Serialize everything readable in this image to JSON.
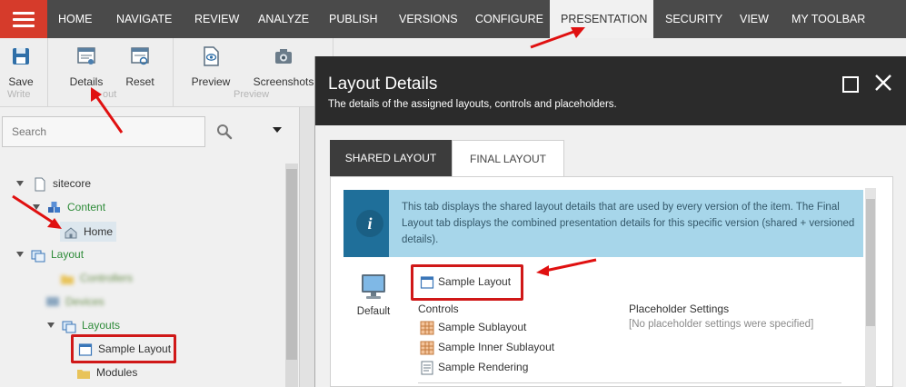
{
  "nav": {
    "tabs": [
      {
        "label": "HOME"
      },
      {
        "label": "NAVIGATE"
      },
      {
        "label": "REVIEW"
      },
      {
        "label": "ANALYZE"
      },
      {
        "label": "PUBLISH"
      },
      {
        "label": "VERSIONS"
      },
      {
        "label": "CONFIGURE"
      },
      {
        "label": "PRESENTATION"
      },
      {
        "label": "SECURITY"
      },
      {
        "label": "VIEW"
      },
      {
        "label": "MY TOOLBAR"
      }
    ],
    "active_tab": "PRESENTATION"
  },
  "ribbon": {
    "save": "Save",
    "details": "Details",
    "reset": "Reset",
    "preview": "Preview",
    "screenshots": "Screenshots",
    "groups": {
      "write": "Write",
      "layout_partial": "out",
      "preview": "Preview"
    }
  },
  "tree": {
    "search_placeholder": "Search",
    "items": [
      {
        "label": "sitecore"
      },
      {
        "label": "Content"
      },
      {
        "label": "Home"
      },
      {
        "label": "Layout"
      },
      {
        "label": "Controllers"
      },
      {
        "label": "Devices"
      },
      {
        "label": "Layouts"
      },
      {
        "label": "Sample Layout"
      },
      {
        "label": "Modules"
      }
    ]
  },
  "modal": {
    "title": "Layout Details",
    "subtitle": "The details of the assigned layouts, controls and placeholders.",
    "tabs": [
      {
        "label": "SHARED LAYOUT"
      },
      {
        "label": "FINAL LAYOUT"
      }
    ],
    "info": {
      "icon_letter": "i",
      "text": "This tab displays the shared layout details that are used by every version of the item. The Final Layout tab displays the combined presentation details for this specific version (shared + versioned details)."
    },
    "device_label": "Default",
    "layout_name": "Sample Layout",
    "controls_label": "Controls",
    "controls": [
      {
        "label": "Sample Sublayout"
      },
      {
        "label": "Sample Inner Sublayout"
      },
      {
        "label": "Sample Rendering"
      }
    ],
    "placeholder_label": "Placeholder Settings",
    "placeholder_empty": "[No placeholder settings were specified]"
  },
  "colors": {
    "accent_red": "#d63b2b",
    "nav_bg": "#4a4a4a",
    "modal_header": "#2b2b2b",
    "info_bg": "#a7d6ea",
    "highlight_red": "#d01818",
    "tree_green": "#2f8c3a"
  }
}
